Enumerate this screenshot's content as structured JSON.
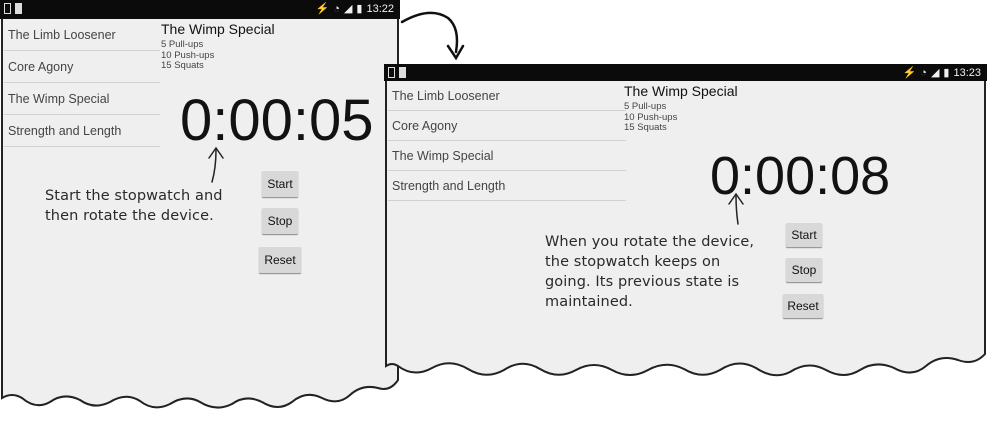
{
  "left_device": {
    "status_time": "13:22",
    "workouts": [
      "The Limb Loosener",
      "Core Agony",
      "The Wimp Special",
      "Strength and Length"
    ],
    "detail": {
      "title": "The Wimp Special",
      "description": [
        "5 Pull-ups",
        "10 Push-ups",
        "15 Squats"
      ]
    },
    "stopwatch": "0:00:05",
    "buttons": {
      "start": "Start",
      "stop": "Stop",
      "reset": "Reset"
    }
  },
  "right_device": {
    "status_time": "13:23",
    "workouts": [
      "The Limb Loosener",
      "Core Agony",
      "The Wimp Special",
      "Strength and Length"
    ],
    "detail": {
      "title": "The Wimp Special",
      "description": [
        "5 Pull-ups",
        "10 Push-ups",
        "15 Squats"
      ]
    },
    "stopwatch": "0:00:08",
    "buttons": {
      "start": "Start",
      "stop": "Stop",
      "reset": "Reset"
    }
  },
  "annotations": {
    "left": [
      "Start the stopwatch and",
      "then rotate the device."
    ],
    "right": [
      "When you rotate the device,",
      "the stopwatch keeps on",
      "going. Its previous state is",
      "maintained."
    ]
  },
  "icons": {
    "status_left": [
      "sim-icon",
      "notification-icon"
    ],
    "status_right": [
      "no-sound-icon",
      "wifi-icon",
      "signal-icon",
      "battery-icon"
    ]
  }
}
